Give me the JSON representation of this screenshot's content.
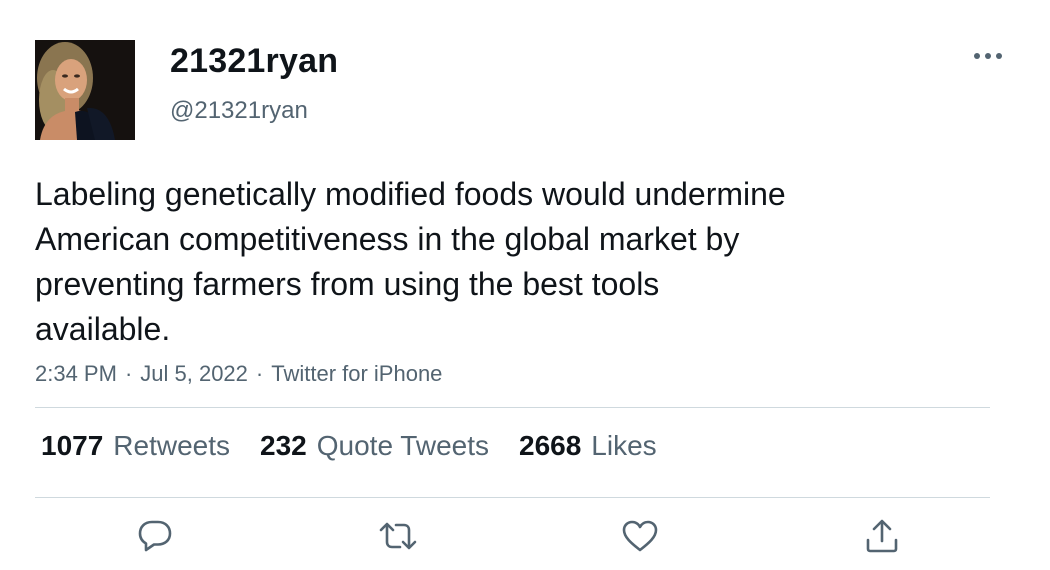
{
  "tweet": {
    "display_name": "21321ryan",
    "handle": "@21321ryan",
    "text": "Labeling genetically modified foods would undermine\nAmerican competitiveness in the global market by\npreventing farmers from using the best tools\navailable.",
    "time": "2:34 PM",
    "date": "Jul 5, 2022",
    "source": "Twitter for iPhone",
    "separator": "·"
  },
  "stats": {
    "retweets_count": "1077",
    "retweets_label": "Retweets",
    "quotes_count": "232",
    "quotes_label": "Quote Tweets",
    "likes_count": "2668",
    "likes_label": "Likes"
  },
  "icons": {
    "more": "more-horizontal-icon",
    "reply": "reply-bubble-icon",
    "retweet": "retweet-icon",
    "like": "heart-icon",
    "share": "share-upload-icon"
  },
  "colors": {
    "text_primary": "#0f1419",
    "text_secondary": "#536471",
    "divider": "#cfd9de"
  }
}
